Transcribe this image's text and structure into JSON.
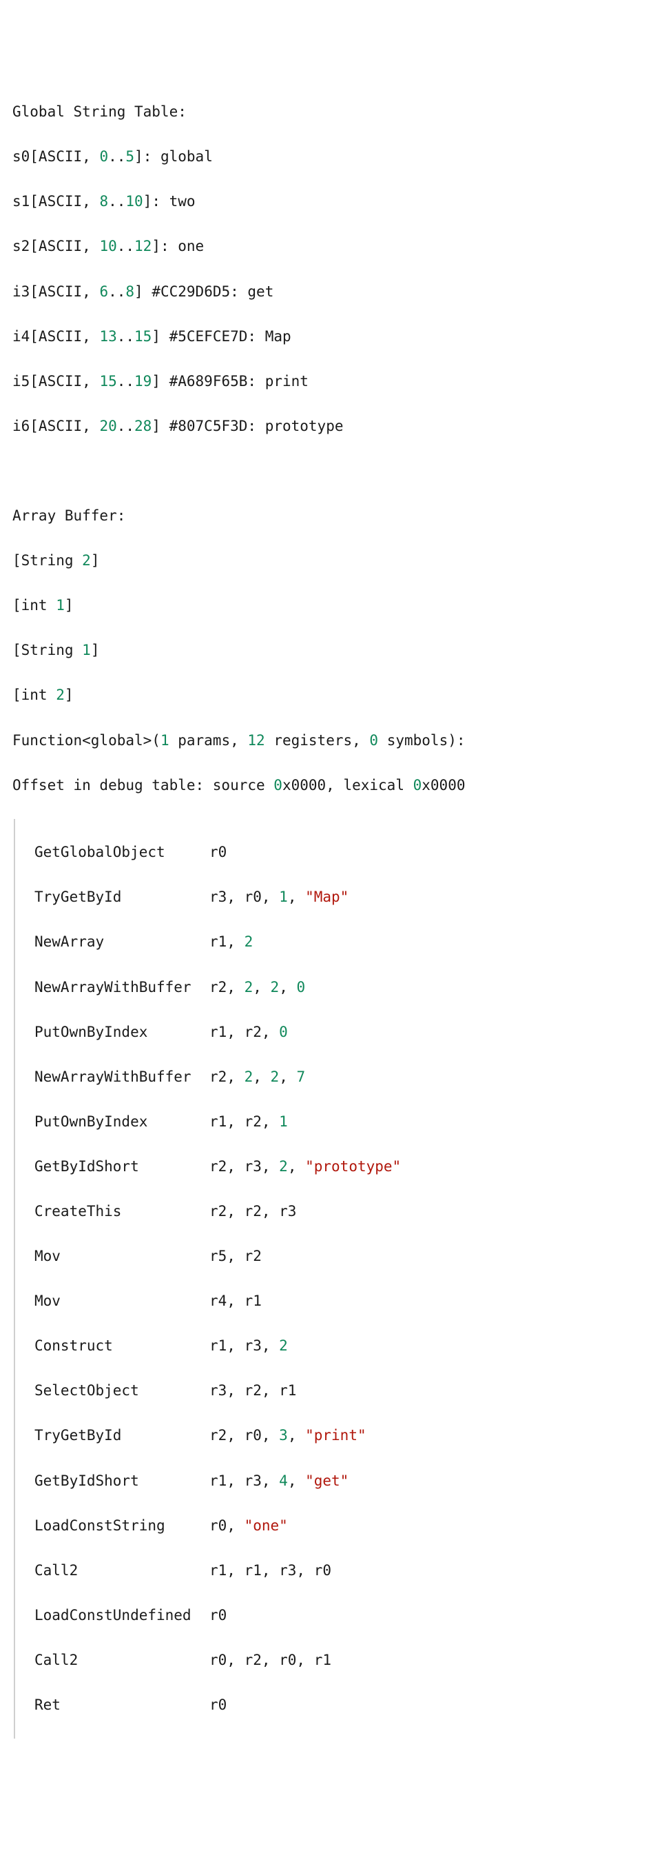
{
  "globalStringTableHeader": "Global String Table:",
  "strings": {
    "s0": {
      "label": "s0[ASCII, ",
      "range_from": "0",
      "mid": "..",
      "range_to": "5",
      "end": "]: global"
    },
    "s1": {
      "label": "s1[ASCII, ",
      "range_from": "8",
      "mid": "..",
      "range_to": "10",
      "end": "]: two"
    },
    "s2": {
      "label": "s2[ASCII, ",
      "range_from": "10",
      "mid": "..",
      "range_to": "12",
      "end": "]: one"
    },
    "i3": {
      "label": "i3[ASCII, ",
      "range_from": "6",
      "mid": "..",
      "range_to": "8",
      "end": "] #CC29D6D5: get"
    },
    "i4": {
      "label": "i4[ASCII, ",
      "range_from": "13",
      "mid": "..",
      "range_to": "15",
      "end": "] #5CEFCE7D: Map"
    },
    "i5": {
      "label": "i5[ASCII, ",
      "range_from": "15",
      "mid": "..",
      "range_to": "19",
      "end": "] #A689F65B: print"
    },
    "i6": {
      "label": "i6[ASCII, ",
      "range_from": "20",
      "mid": "..",
      "range_to": "28",
      "end": "] #807C5F3D: prototype"
    }
  },
  "arrayBufferHeader": "Array Buffer:",
  "arrayBuffer": {
    "L0": {
      "pre": "[String ",
      "val": "2",
      "post": "]"
    },
    "L1": {
      "pre": "[int ",
      "val": "1",
      "post": "]"
    },
    "L2": {
      "pre": "[String ",
      "val": "1",
      "post": "]"
    },
    "L3": {
      "pre": "[int ",
      "val": "2",
      "post": "]"
    }
  },
  "funcHeader": {
    "pre": "Function<global>(",
    "params": "1",
    "mid1": " params, ",
    "registers": "12",
    "mid2": " registers, ",
    "symbols": "0",
    "post": " symbols):"
  },
  "offsetLine": {
    "pre": "Offset in debug table: source ",
    "source": "0",
    "mid": "x0000, lexical ",
    "lexical": "0",
    "post": "x0000"
  },
  "instructions": {
    "i00": {
      "op": "GetGlobalObject",
      "tail": "r0"
    },
    "i01": {
      "op": "TryGetById",
      "tail1": "r3, r0, ",
      "num": "1",
      "tail2": ", ",
      "str": "\"Map\""
    },
    "i02": {
      "op": "NewArray",
      "tail1": "r1, ",
      "num": "2"
    },
    "i03": {
      "op": "NewArrayWithBuffer",
      "tail1": "r2, ",
      "n1": "2",
      "c1": ", ",
      "n2": "2",
      "c2": ", ",
      "n3": "0"
    },
    "i04": {
      "op": "PutOwnByIndex",
      "tail1": "r1, r2, ",
      "num": "0"
    },
    "i05": {
      "op": "NewArrayWithBuffer",
      "tail1": "r2, ",
      "n1": "2",
      "c1": ", ",
      "n2": "2",
      "c2": ", ",
      "n3": "7"
    },
    "i06": {
      "op": "PutOwnByIndex",
      "tail1": "r1, r2, ",
      "num": "1"
    },
    "i07": {
      "op": "GetByIdShort",
      "tail1": "r2, r3, ",
      "num": "2",
      "tail2": ", ",
      "str": "\"prototype\""
    },
    "i08": {
      "op": "CreateThis",
      "tail": "r2, r2, r3"
    },
    "i09": {
      "op": "Mov",
      "tail": "r5, r2"
    },
    "i10": {
      "op": "Mov",
      "tail": "r4, r1"
    },
    "i11": {
      "op": "Construct",
      "tail1": "r1, r3, ",
      "num": "2"
    },
    "i12": {
      "op": "SelectObject",
      "tail": "r3, r2, r1"
    },
    "i13": {
      "op": "TryGetById",
      "tail1": "r2, r0, ",
      "num": "3",
      "tail2": ", ",
      "str": "\"print\""
    },
    "i14": {
      "op": "GetByIdShort",
      "tail1": "r1, r3, ",
      "num": "4",
      "tail2": ", ",
      "str": "\"get\""
    },
    "i15": {
      "op": "LoadConstString",
      "tail1": "r0, ",
      "str": "\"one\""
    },
    "i16": {
      "op": "Call2",
      "tail": "r1, r1, r3, r0"
    },
    "i17": {
      "op": "LoadConstUndefined",
      "tail": "r0"
    },
    "i18": {
      "op": "Call2",
      "tail": "r0, r2, r0, r1"
    },
    "i19": {
      "op": "Ret",
      "tail": "r0"
    }
  }
}
